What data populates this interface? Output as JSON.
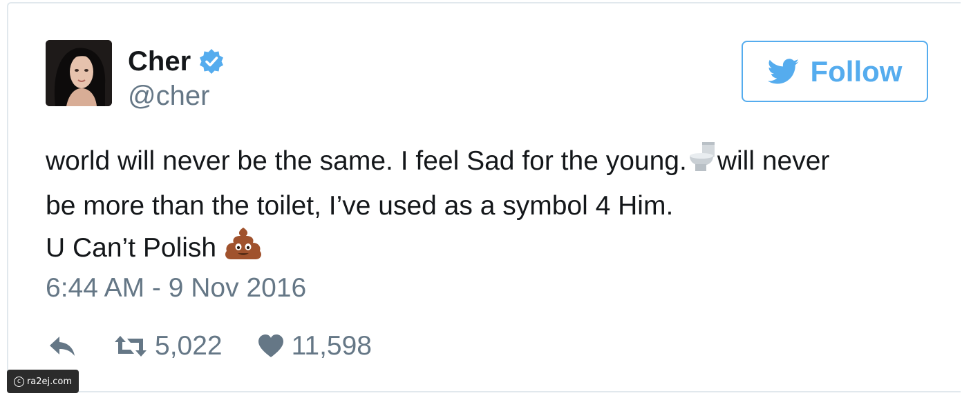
{
  "user": {
    "name": "Cher",
    "handle": "@cher"
  },
  "follow_button": {
    "label": "Follow"
  },
  "tweet": {
    "line1_before_emoji": "world will never be the same. I feel Sad for the young.",
    "line1_after_emoji": "will never",
    "line2": "be more than the toilet, I’ve used as a symbol 4 Him.",
    "line3": "U Can’t Polish",
    "timestamp": "6:44 AM - 9 Nov 2016",
    "emojis": [
      "toilet-emoji",
      "pile-of-poo-emoji"
    ]
  },
  "actions": {
    "retweets": "5,022",
    "likes": "11,598"
  },
  "watermark": {
    "text": "ra2ej.com"
  },
  "colors": {
    "twitter_blue": "#55acee",
    "muted_text": "#657786",
    "main_text": "#14171a",
    "border": "#e1e8ed"
  }
}
